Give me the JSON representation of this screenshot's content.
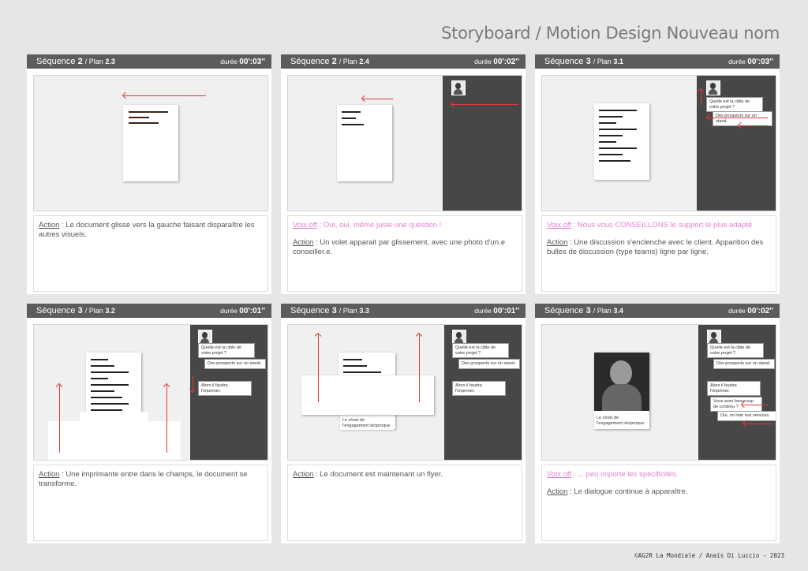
{
  "page_title": "Storyboard / Motion Design Nouveau nom",
  "footer": "©AG2R La Mondiale / Anaïs Di Luccio - 2023",
  "labels": {
    "sequence": "Séquence",
    "plan": "/ Plan",
    "duree": "durée",
    "action": "Action",
    "voix_off": "Voix off"
  },
  "panels": [
    {
      "seq": "2",
      "plan": "2.3",
      "duree": "00':03''",
      "voix": "",
      "action": ": Le document glisse vers la gauche faisant disparaître les autres visuels."
    },
    {
      "seq": "2",
      "plan": "2.4",
      "duree": "00':02''",
      "voix": ": Oui, oui, même juste une question !",
      "action": ": Un volet apparait par glissement, avec une photo d'un.e conseiller.e."
    },
    {
      "seq": "3",
      "plan": "3.1",
      "duree": "00':03''",
      "voix": ": Nous vous CONSEILLONS le support le plus adapté",
      "action": ": Une discussion s'enclenche avec le client. Apparition des bulles de discussion (type teams) ligne par ligne."
    },
    {
      "seq": "3",
      "plan": "3.2",
      "duree": "00':01''",
      "voix": "",
      "action": ": Une imprimante entre dans le champs, le document se transforme."
    },
    {
      "seq": "3",
      "plan": "3.3",
      "duree": "00':01''",
      "voix": "",
      "action": ": Le document est maintenant un flyer."
    },
    {
      "seq": "3",
      "plan": "3.4",
      "duree": "00':02''",
      "voix": ": ... peu importe les spécificités,",
      "action": ": Le dialogue continue à apparaître."
    }
  ],
  "chat": {
    "q1": "Quelle est la cible de votre projet ?",
    "r1": "Des prospects sur un stand.",
    "q2": "Alors il faudra l'imprimer.",
    "q3": "Vous avez beaucoup de contenu ?",
    "r3": "Oui, on liste nos services."
  },
  "flyer_caption": "Le choix de l'engagement réciproque"
}
